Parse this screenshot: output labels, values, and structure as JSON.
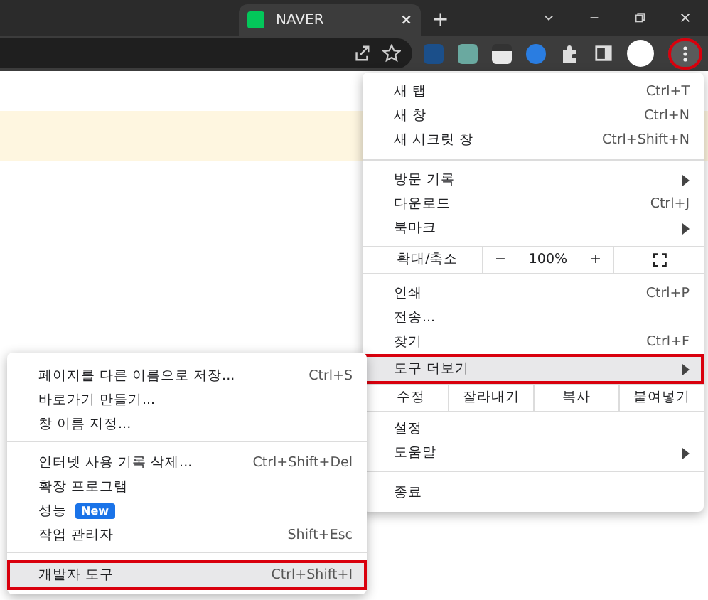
{
  "tab": {
    "title": "NAVER",
    "selected": true,
    "close": "×"
  },
  "new_tab": "+",
  "main_menu": {
    "sections": [
      {
        "items": [
          {
            "kind": "item",
            "label": "새 탭",
            "shortcut": "Ctrl+T"
          },
          {
            "kind": "item",
            "label": "새 창",
            "shortcut": "Ctrl+N"
          },
          {
            "kind": "item",
            "label": "새 시크릿 창",
            "shortcut": "Ctrl+Shift+N"
          }
        ]
      },
      {
        "items": [
          {
            "kind": "item",
            "label": "방문 기록",
            "submenu": true
          },
          {
            "kind": "item",
            "label": "다운로드",
            "shortcut": "Ctrl+J"
          },
          {
            "kind": "item",
            "label": "북마크",
            "submenu": true
          }
        ]
      },
      {
        "items": [
          {
            "kind": "zoom",
            "label": "확대/축소",
            "minus": "−",
            "value": "100%",
            "plus": "+"
          }
        ]
      },
      {
        "items": [
          {
            "kind": "item",
            "label": "인쇄",
            "shortcut": "Ctrl+P"
          },
          {
            "kind": "item",
            "label": "전송..."
          },
          {
            "kind": "item",
            "label": "찾기",
            "shortcut": "Ctrl+F"
          },
          {
            "kind": "item",
            "label": "도구 더보기",
            "submenu": true,
            "selected": true,
            "annotated": true
          }
        ]
      },
      {
        "items": [
          {
            "kind": "edit",
            "label": "수정",
            "buttons": [
              "잘라내기",
              "복사",
              "붙여넣기"
            ]
          }
        ]
      },
      {
        "items": [
          {
            "kind": "item",
            "label": "설정"
          },
          {
            "kind": "item",
            "label": "도움말",
            "submenu": true
          }
        ]
      },
      {
        "items": [
          {
            "kind": "item",
            "label": "종료"
          }
        ]
      }
    ]
  },
  "sub_menu": {
    "sections": [
      {
        "items": [
          {
            "kind": "item",
            "label": "페이지를 다른 이름으로 저장...",
            "shortcut": "Ctrl+S"
          },
          {
            "kind": "item",
            "label": "바로가기 만들기..."
          },
          {
            "kind": "item",
            "label": "창 이름 지정..."
          }
        ]
      },
      {
        "items": [
          {
            "kind": "item",
            "label": "인터넷 사용 기록 삭제...",
            "shortcut": "Ctrl+Shift+Del"
          },
          {
            "kind": "item",
            "label": "확장 프로그램"
          },
          {
            "kind": "item",
            "label": "성능",
            "badge": "New"
          },
          {
            "kind": "item",
            "label": "작업 관리자",
            "shortcut": "Shift+Esc"
          }
        ]
      },
      {
        "items": [
          {
            "kind": "item",
            "label": "개발자 도구",
            "shortcut": "Ctrl+Shift+I",
            "selected": true,
            "annotated": true
          }
        ]
      }
    ]
  },
  "menu_button": {
    "annotated": true
  }
}
